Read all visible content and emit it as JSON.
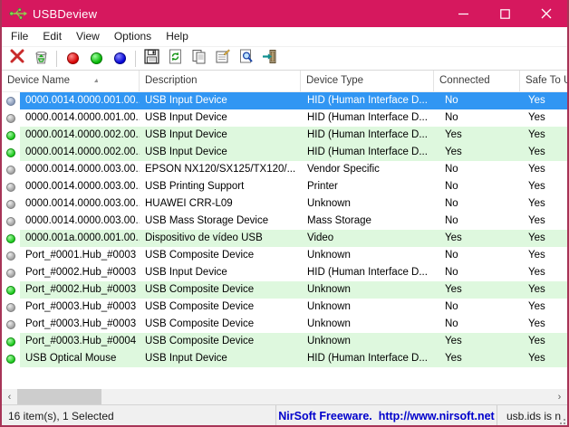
{
  "window": {
    "title": "USBDeview"
  },
  "menu": {
    "items": [
      "File",
      "Edit",
      "View",
      "Options",
      "Help"
    ]
  },
  "toolbar": {
    "icons": [
      "delete-x",
      "uninstall-bin",
      "red-ball",
      "green-ball",
      "blue-ball",
      "save-floppy",
      "refresh",
      "copy",
      "properties",
      "find",
      "exit-door"
    ]
  },
  "table": {
    "columns": [
      "Device Name",
      "Description",
      "Device Type",
      "Connected",
      "Safe To Unplug"
    ],
    "sort_column": "Device Name",
    "rows": [
      {
        "name": "0000.0014.0000.001.00...",
        "description": "USB Input Device",
        "type": "HID (Human Interface D...",
        "connected": "No",
        "safe": "Yes",
        "icon": "blue-gray",
        "state": "selected"
      },
      {
        "name": "0000.0014.0000.001.00...",
        "description": "USB Input Device",
        "type": "HID (Human Interface D...",
        "connected": "No",
        "safe": "Yes",
        "icon": "gray",
        "state": "normal"
      },
      {
        "name": "0000.0014.0000.002.00...",
        "description": "USB Input Device",
        "type": "HID (Human Interface D...",
        "connected": "Yes",
        "safe": "Yes",
        "icon": "green",
        "state": "connected"
      },
      {
        "name": "0000.0014.0000.002.00...",
        "description": "USB Input Device",
        "type": "HID (Human Interface D...",
        "connected": "Yes",
        "safe": "Yes",
        "icon": "green",
        "state": "connected"
      },
      {
        "name": "0000.0014.0000.003.00...",
        "description": "EPSON NX120/SX125/TX120/...",
        "type": "Vendor Specific",
        "connected": "No",
        "safe": "Yes",
        "icon": "gray",
        "state": "normal"
      },
      {
        "name": "0000.0014.0000.003.00...",
        "description": "USB Printing Support",
        "type": "Printer",
        "connected": "No",
        "safe": "Yes",
        "icon": "gray",
        "state": "normal"
      },
      {
        "name": "0000.0014.0000.003.00...",
        "description": "HUAWEI CRR-L09",
        "type": "Unknown",
        "connected": "No",
        "safe": "Yes",
        "icon": "gray",
        "state": "normal"
      },
      {
        "name": "0000.0014.0000.003.00...",
        "description": "USB Mass Storage Device",
        "type": "Mass Storage",
        "connected": "No",
        "safe": "Yes",
        "icon": "gray",
        "state": "normal"
      },
      {
        "name": "0000.001a.0000.001.00...",
        "description": "Dispositivo de vídeo USB",
        "type": "Video",
        "connected": "Yes",
        "safe": "Yes",
        "icon": "green",
        "state": "connected"
      },
      {
        "name": "Port_#0001.Hub_#0003",
        "description": "USB Composite Device",
        "type": "Unknown",
        "connected": "No",
        "safe": "Yes",
        "icon": "gray",
        "state": "normal"
      },
      {
        "name": "Port_#0002.Hub_#0003",
        "description": "USB Input Device",
        "type": "HID (Human Interface D...",
        "connected": "No",
        "safe": "Yes",
        "icon": "gray",
        "state": "normal"
      },
      {
        "name": "Port_#0002.Hub_#0003",
        "description": "USB Composite Device",
        "type": "Unknown",
        "connected": "Yes",
        "safe": "Yes",
        "icon": "green",
        "state": "connected"
      },
      {
        "name": "Port_#0003.Hub_#0003",
        "description": "USB Composite Device",
        "type": "Unknown",
        "connected": "No",
        "safe": "Yes",
        "icon": "gray",
        "state": "normal"
      },
      {
        "name": "Port_#0003.Hub_#0003",
        "description": "USB Composite Device",
        "type": "Unknown",
        "connected": "No",
        "safe": "Yes",
        "icon": "gray",
        "state": "normal"
      },
      {
        "name": "Port_#0003.Hub_#0004",
        "description": "USB Composite Device",
        "type": "Unknown",
        "connected": "Yes",
        "safe": "Yes",
        "icon": "green",
        "state": "connected"
      },
      {
        "name": "USB Optical Mouse",
        "description": "USB Input Device",
        "type": "HID (Human Interface D...",
        "connected": "Yes",
        "safe": "Yes",
        "icon": "green",
        "state": "connected"
      }
    ]
  },
  "statusbar": {
    "left": "16 item(s), 1 Selected",
    "center": "NirSoft Freeware.  http://www.nirsoft.net",
    "right": "usb.ids is n"
  },
  "colors": {
    "titlebar": "#d6185e",
    "selection": "#3196f3",
    "connected_row": "#def8de",
    "link": "#0000cc"
  }
}
